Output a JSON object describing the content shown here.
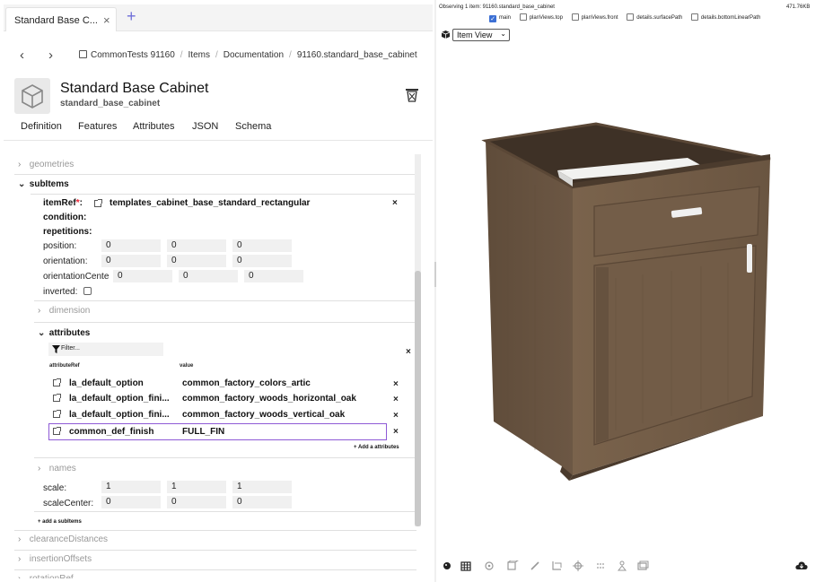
{
  "tab": {
    "title": "Standard Base C...",
    "close": "×",
    "add": "+"
  },
  "breadcrumb": [
    "CommonTests 91160",
    "Items",
    "Documentation",
    "91160.standard_base_cabinet"
  ],
  "header": {
    "title": "Standard Base Cabinet",
    "subtitle": "standard_base_cabinet"
  },
  "subnav": [
    "Definition",
    "Features",
    "Attributes",
    "JSON",
    "Schema"
  ],
  "tree": {
    "geometries": "geometries",
    "subItems": "subItems",
    "itemRef_label": "itemRef",
    "itemRef_required": "*",
    "itemRef_value": "templates_cabinet_base_standard_rectangular",
    "condition": "condition:",
    "repetitions": "repetitions:",
    "position_label": "position:",
    "position": [
      "0",
      "0",
      "0"
    ],
    "orientation_label": "orientation:",
    "orientation": [
      "0",
      "0",
      "0"
    ],
    "orientationCenter_label": "orientationCente",
    "orientationCenter": [
      "0",
      "0",
      "0"
    ],
    "inverted_label": "inverted:",
    "dimension": "dimension",
    "attributes": "attributes",
    "filter_placeholder": "Filter...",
    "col_attributeRef": "attributeRef",
    "col_value": "value",
    "attr_rows": [
      {
        "ref": "la_default_option",
        "value": "common_factory_colors_artic"
      },
      {
        "ref": "la_default_option_fini...",
        "value": "common_factory_woods_horizontal_oak"
      },
      {
        "ref": "la_default_option_fini...",
        "value": "common_factory_woods_vertical_oak"
      },
      {
        "ref": "common_def_finish",
        "value": "FULL_FIN"
      }
    ],
    "add_attributes": "+ Add a attributes",
    "names": "names",
    "scale_label": "scale:",
    "scale": [
      "1",
      "1",
      "1"
    ],
    "scaleCenter_label": "scaleCenter:",
    "scaleCenter": [
      "0",
      "0",
      "0"
    ],
    "add_subitems": "+ add a subItems",
    "clearanceDistances": "clearanceDistances",
    "insertionOffsets": "insertionOffsets",
    "next_partial": "rotationRef"
  },
  "viewer": {
    "observing": "Observing 1 item: 91160.standard_base_cabinet",
    "size": "471.76KB",
    "checks": [
      {
        "label": "main",
        "checked": true
      },
      {
        "label": "planViews.top",
        "checked": false
      },
      {
        "label": "planViews.front",
        "checked": false
      },
      {
        "label": "details.surfacePath",
        "checked": false
      },
      {
        "label": "details.bottomLinearPath",
        "checked": false
      }
    ],
    "view_select": "Item View"
  },
  "colors": {
    "accent": "#6e6ed8",
    "selection": "#8e5ad6",
    "wood": "#6e5a45"
  }
}
